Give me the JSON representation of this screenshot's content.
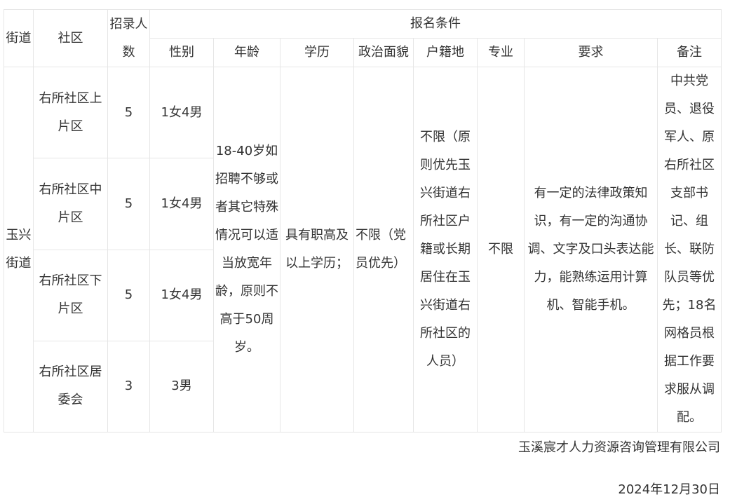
{
  "table": {
    "headers": {
      "street": "街道",
      "community": "社区",
      "quota": "招录人数",
      "conditions": "报名条件",
      "gender": "性别",
      "age": "年龄",
      "education": "学历",
      "political": "政治面貌",
      "hukou": "户籍地",
      "major": "专业",
      "requirements": "要求",
      "remarks": "备注"
    },
    "street": "玉兴街道",
    "rows": [
      {
        "community": "右所社区上片区",
        "quota": "5",
        "gender": "1女4男"
      },
      {
        "community": "右所社区中片区",
        "quota": "5",
        "gender": "1女4男"
      },
      {
        "community": "右所社区下片区",
        "quota": "5",
        "gender": "1女4男"
      },
      {
        "community": "右所社区居委会",
        "quota": "3",
        "gender": "3男"
      }
    ],
    "shared": {
      "age": "18-40岁如招聘不够或者其它特殊情况可以适当放宽年龄，原则不高于50周岁。",
      "education": "具有职高及以上学历；",
      "political": "不限（党员优先）",
      "hukou": "不限（原则优先玉兴街道右所社区户籍或长期居住在玉兴街道右所社区的人员）",
      "major": "不限",
      "requirements": "有一定的法律政策知识，有一定的沟通协调、文字及口头表达能力，能熟练运用计算机、智能手机。",
      "remarks": "中共党员、退役军人、原右所社区支部书记、组长、联防队员等优先；18名网格员根据工作要求服从调配。"
    }
  },
  "footer": {
    "company": "玉溪宸才人力资源咨询管理有限公司",
    "date": "2024年12月30日"
  }
}
